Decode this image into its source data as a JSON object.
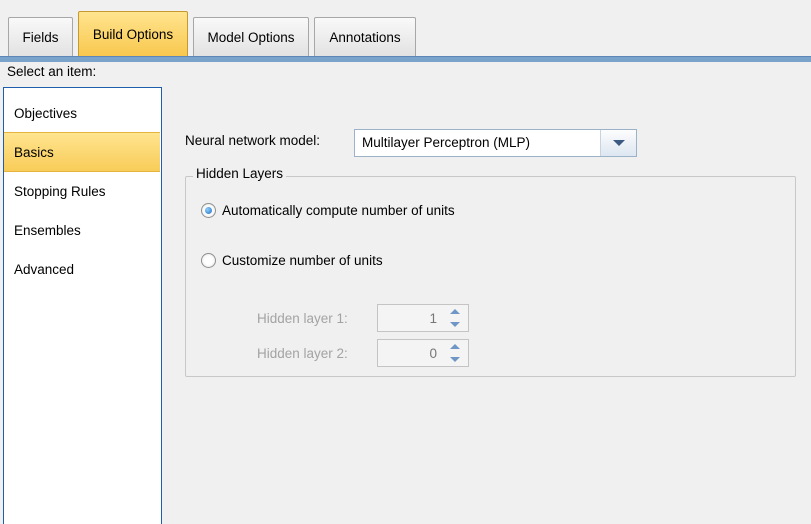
{
  "tabs": [
    {
      "label": "Fields",
      "active": false
    },
    {
      "label": "Build Options",
      "active": true
    },
    {
      "label": "Model Options",
      "active": false
    },
    {
      "label": "Annotations",
      "active": false
    }
  ],
  "select_prompt": "Select an item:",
  "items": [
    {
      "label": "Objectives",
      "selected": false
    },
    {
      "label": "Basics",
      "selected": true
    },
    {
      "label": "Stopping Rules",
      "selected": false
    },
    {
      "label": "Ensembles",
      "selected": false
    },
    {
      "label": "Advanced",
      "selected": false
    }
  ],
  "basics": {
    "model_label": "Neural network model:",
    "model_value": "Multilayer Perceptron (MLP)",
    "hidden_layers_title": "Hidden Layers",
    "auto_units_label": "Automatically compute number of units",
    "auto_units_checked": true,
    "custom_units_label": "Customize number of units",
    "custom_units_checked": false,
    "hidden_layer_1_label": "Hidden layer 1:",
    "hidden_layer_1_value": "1",
    "hidden_layer_2_label": "Hidden layer 2:",
    "hidden_layer_2_value": "0"
  },
  "colors": {
    "active_tab": "#f8c84e",
    "selection": "#ffe48f",
    "list_border": "#1f5eac",
    "tab_rule": "#7aa3cc",
    "disabled_text": "#a3a3a3"
  },
  "icons": {
    "model_dropdown": "chevron-down-icon",
    "spin_up": "spin-up-icon",
    "spin_down": "spin-down-icon"
  }
}
